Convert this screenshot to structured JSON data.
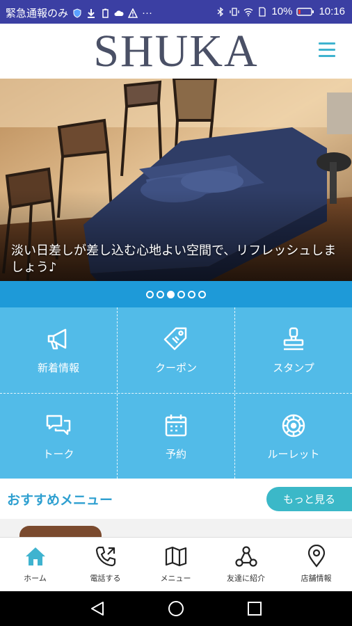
{
  "status_bar": {
    "left_text": "緊急通報のみ",
    "battery": "10%",
    "time": "10:16",
    "icons_left": [
      "shield-icon",
      "download-icon",
      "battery-saver-icon",
      "cloud-icon",
      "warning-icon",
      "more-icon"
    ],
    "icons_right": [
      "bluetooth-icon",
      "vibrate-icon",
      "wifi-icon",
      "sim-icon",
      "battery-icon"
    ]
  },
  "header": {
    "logo": "SHUKA",
    "menu_icon": "hamburger-icon"
  },
  "hero": {
    "caption": "淡い日差しが差し込む心地よい空間で、リフレッシュしましょう♪",
    "slide_count": 6,
    "active_slide": 3
  },
  "grid": {
    "items": [
      {
        "label": "新着情報",
        "icon": "megaphone-icon"
      },
      {
        "label": "クーポン",
        "icon": "coupon-tag-icon"
      },
      {
        "label": "スタンプ",
        "icon": "stamp-icon"
      },
      {
        "label": "トーク",
        "icon": "chat-icon"
      },
      {
        "label": "予約",
        "icon": "calendar-icon"
      },
      {
        "label": "ルーレット",
        "icon": "roulette-icon"
      }
    ]
  },
  "recommend": {
    "title": "おすすめメニュー",
    "more_label": "もっと見る"
  },
  "tabbar": {
    "tabs": [
      {
        "label": "ホーム",
        "icon": "home-icon"
      },
      {
        "label": "電話する",
        "icon": "phone-icon"
      },
      {
        "label": "メニュー",
        "icon": "map-icon"
      },
      {
        "label": "友達に紹介",
        "icon": "share-icon"
      },
      {
        "label": "店舗情報",
        "icon": "location-pin-icon"
      }
    ]
  },
  "colors": {
    "status_bar": "#3b3fa3",
    "grid_bg": "#52bbe8",
    "dots_bg": "#1e9ad8",
    "accent": "#3bb8c8",
    "logo": "#4a5066",
    "home_tab": "#3fb3cf"
  }
}
